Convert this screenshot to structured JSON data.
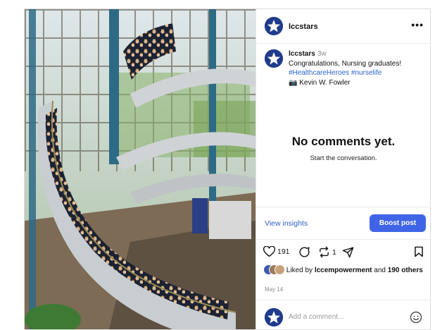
{
  "post": {
    "username": "lccstars",
    "more_label": "•••",
    "caption": {
      "username": "lccstars",
      "time": "3w",
      "text": "Congratulations, Nursing graduates!",
      "hashtags": "#HealthcareHeroes #nurselife",
      "credit": "📷 Kevin W. Fowler"
    },
    "empty": {
      "title": "No comments yet.",
      "subtitle": "Start the conversation."
    },
    "view_insights": "View insights",
    "boost_label": "Boost post",
    "stats": {
      "likes": "191",
      "reposts": "1"
    },
    "liked_by": {
      "prefix": "Liked by",
      "user": "lccempowerment",
      "and": "and",
      "others": "190 others"
    },
    "date": "May 14",
    "comment_placeholder": "Add a comment..."
  },
  "colors": {
    "brand_blue": "#1f3b8c",
    "link_blue": "#2f5fc9",
    "boost_button": "#4064e6"
  },
  "icons": [
    "more-dots-icon",
    "heart-icon",
    "comment-icon",
    "repost-icon",
    "share-icon",
    "bookmark-icon",
    "emoji-icon"
  ]
}
